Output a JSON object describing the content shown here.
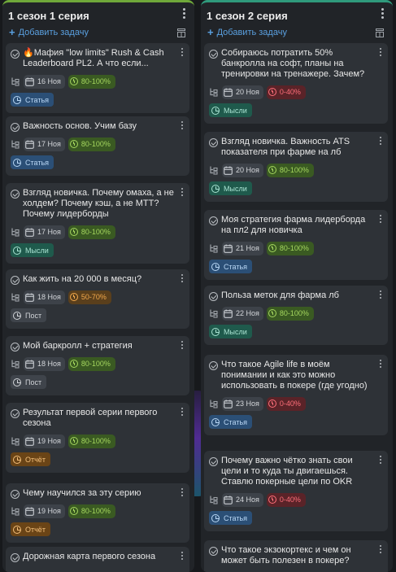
{
  "colors": {
    "accent_left": "#6fa83a",
    "accent_right": "#2f9a7c",
    "link": "#5aa0e0"
  },
  "columns": [
    {
      "title": "1 сезон 1 серия",
      "add_label": "Добавить задачу",
      "cards": [
        {
          "title": "🔥Мафия \"low limits\" Rush & Cash Leaderboard PL2. А что если...",
          "date": "16 Ноя",
          "priority": "80-100%",
          "prio": "green",
          "tag": "Статья",
          "tag_color": "blue"
        },
        {
          "title": "Важность основ. Учим базу",
          "date": "17 Ноя",
          "priority": "80-100%",
          "prio": "green",
          "tag": "Статья",
          "tag_color": "blue"
        },
        {
          "title": "Взгляд новичка. Почему омаха, а не холдем? Почему кэш, а не МТТ?Почему лидерборды",
          "date": "17 Ноя",
          "priority": "80-100%",
          "prio": "green",
          "tag": "Мысли",
          "tag_color": "teal"
        },
        {
          "title": "Как жить на 20 000 в месяц?",
          "date": "18 Ноя",
          "priority": "50-70%",
          "prio": "orange",
          "tag": "Пост",
          "tag_color": "grey"
        },
        {
          "title": "Мой баркролл + стратегия",
          "date": "18 Ноя",
          "priority": "80-100%",
          "prio": "green",
          "tag": "Пост",
          "tag_color": "grey"
        },
        {
          "title": "Результат первой серии первого сезона",
          "date": "19 Ноя",
          "priority": "80-100%",
          "prio": "green",
          "tag": "Отчёт",
          "tag_color": "orange"
        },
        {
          "title": "Чему научился за эту серию",
          "date": "19 Ноя",
          "priority": "80-100%",
          "prio": "green",
          "tag": "Отчёт",
          "tag_color": "orange"
        },
        {
          "title": "Дорожная карта первого сезона",
          "date": "",
          "priority": "",
          "prio": "",
          "tag": "",
          "tag_color": ""
        }
      ]
    },
    {
      "title": "1 сезон 2 серия",
      "add_label": "Добавить задачу",
      "cards": [
        {
          "title": "Собираюсь потратить 50% банкролла на софт, планы на тренировки на тренажере. Зачем?",
          "date": "20 Ноя",
          "priority": "0-40%",
          "prio": "red",
          "tag": "Мысли",
          "tag_color": "teal"
        },
        {
          "title": "Взгляд новичка. Важность ATS показателя при фарме на лб",
          "date": "20 Ноя",
          "priority": "80-100%",
          "prio": "green",
          "tag": "Мысли",
          "tag_color": "teal"
        },
        {
          "title": "Моя стратегия фарма лидерборда на пл2 для новичка",
          "date": "21 Ноя",
          "priority": "80-100%",
          "prio": "green",
          "tag": "Статья",
          "tag_color": "blue"
        },
        {
          "title": "Польза меток для фарма лб",
          "date": "22 Ноя",
          "priority": "80-100%",
          "prio": "green",
          "tag": "Мысли",
          "tag_color": "teal"
        },
        {
          "title": "Что такое Agile life в моём понимании и как это можно использовать в покере (где угодно)",
          "date": "23 Ноя",
          "priority": "0-40%",
          "prio": "red",
          "tag": "Статья",
          "tag_color": "blue"
        },
        {
          "title": "Почему важно чётко знать свои цели и то куда ты двигаешься. Ставлю покерные цели по OKR",
          "date": "24 Ноя",
          "priority": "0-40%",
          "prio": "red",
          "tag": "Статья",
          "tag_color": "blue"
        },
        {
          "title": "Что такое экзокортекс и чем он может быть полезен в покере?",
          "date": "",
          "priority": "",
          "prio": "",
          "tag": "",
          "tag_color": ""
        }
      ]
    }
  ]
}
